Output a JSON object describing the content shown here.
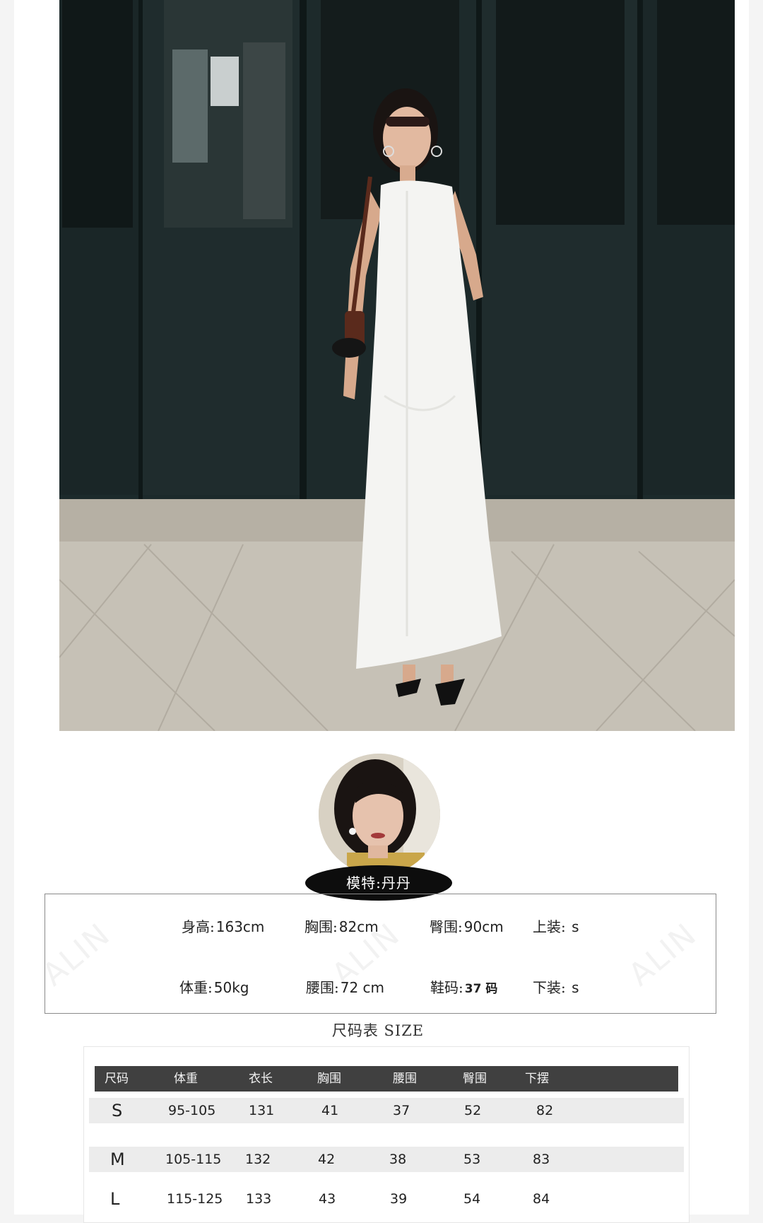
{
  "model": {
    "name_label": "模特:丹丹",
    "stats": [
      {
        "label": "身高:",
        "value": "163cm"
      },
      {
        "label": "胸围:",
        "value": "82cm"
      },
      {
        "label": "臀围:",
        "value": "90cm"
      },
      {
        "label": "上装:",
        "value": "s"
      },
      {
        "label": "体重:",
        "value": "50kg"
      },
      {
        "label": "腰围:",
        "value": "72 cm"
      },
      {
        "label": "鞋码:",
        "value": "37 码"
      },
      {
        "label": "下装:",
        "value": "s"
      }
    ],
    "watermark": "ALIN"
  },
  "size_chart": {
    "title": "尺码表 SIZE",
    "headers": [
      "尺码",
      "体重",
      "衣长",
      "胸围",
      "腰围",
      "臀围",
      "下摆"
    ],
    "rows": [
      [
        "S",
        "95-105",
        "131",
        "41",
        "37",
        "52",
        "82"
      ],
      [
        "M",
        "105-115",
        "132",
        "42",
        "38",
        "53",
        "83"
      ],
      [
        "L",
        "115-125",
        "133",
        "43",
        "39",
        "54",
        "84"
      ]
    ]
  },
  "colors": {
    "header_bg": "#404040",
    "row_shade": "#ececec",
    "name_pill": "#0d0d0d"
  }
}
